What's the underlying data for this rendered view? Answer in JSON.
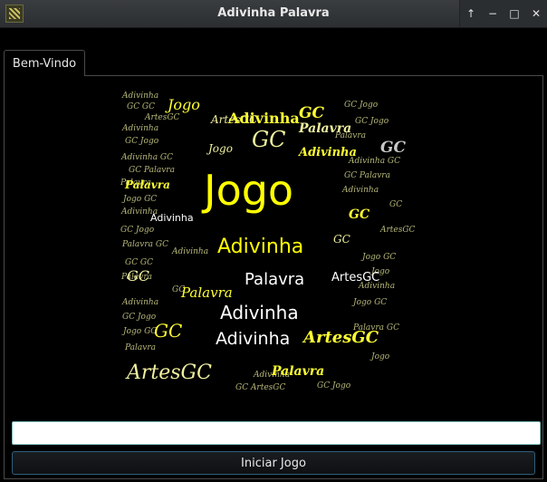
{
  "window": {
    "title": "Adivinha Palavra",
    "controls": [
      "arrow-up-icon",
      "minimize-icon",
      "maximize-icon",
      "close-icon"
    ]
  },
  "tabs": [
    {
      "label": "Bem-Vindo",
      "selected": true
    }
  ],
  "word_cloud": {
    "words": [
      "Jogo",
      "Adivinha",
      "Palavra",
      "ArtesGC",
      "GC",
      "Adivinha",
      "ArtesGC",
      "Palavra",
      "Adivinha",
      "Palavra",
      "Jogo",
      "GC",
      "GC"
    ]
  },
  "input": {
    "value": "",
    "placeholder": ""
  },
  "start_button": {
    "label": "Iniciar Jogo"
  },
  "colors": {
    "accent": "#ffff33",
    "text_pale": "#f0f0a0",
    "bg": "#000000"
  }
}
